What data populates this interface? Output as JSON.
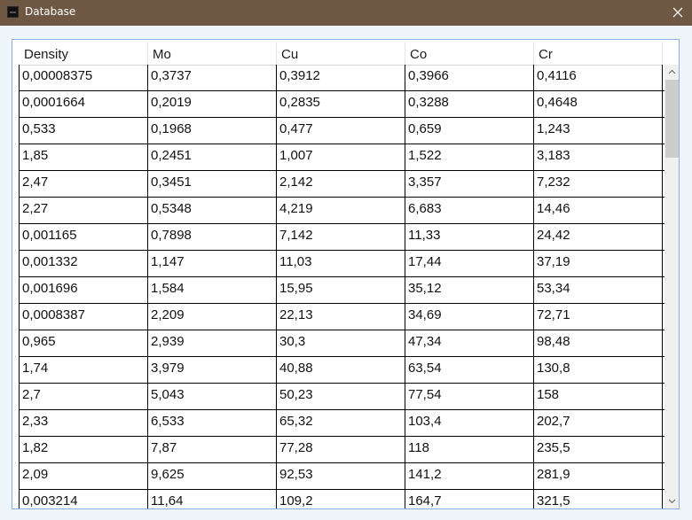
{
  "window": {
    "title": "Database"
  },
  "grid": {
    "columns": [
      "Density",
      "Mo",
      "Cu",
      "Co",
      "Cr"
    ],
    "rows": [
      [
        "0,00008375",
        "0,3737",
        "0,3912",
        "0,3966",
        "0,4116"
      ],
      [
        "0,0001664",
        "0,2019",
        "0,2835",
        "0,3288",
        "0,4648"
      ],
      [
        "0,533",
        "0,1968",
        "0,477",
        "0,659",
        "1,243"
      ],
      [
        "1,85",
        "0,2451",
        "1,007",
        "1,522",
        "3,183"
      ],
      [
        "2,47",
        "0,3451",
        "2,142",
        "3,357",
        "7,232"
      ],
      [
        "2,27",
        "0,5348",
        "4,219",
        "6,683",
        "14,46"
      ],
      [
        "0,001165",
        "0,7898",
        "7,142",
        "11,33",
        "24,42"
      ],
      [
        "0,001332",
        "1,147",
        "11,03",
        "17,44",
        "37,19"
      ],
      [
        "0,001696",
        "1,584",
        "15,95",
        "35,12",
        "53,34"
      ],
      [
        "0,0008387",
        "2,209",
        "22,13",
        "34,69",
        "72,71"
      ],
      [
        "0,965",
        "2,939",
        "30,3",
        "47,34",
        "98,48"
      ],
      [
        "1,74",
        "3,979",
        "40,88",
        "63,54",
        "130,8"
      ],
      [
        "2,7",
        "5,043",
        "50,23",
        "77,54",
        "158"
      ],
      [
        "2,33",
        "6,533",
        "65,32",
        "103,4",
        "202,7"
      ],
      [
        "1,82",
        "7,87",
        "77,28",
        "118",
        "235,5"
      ],
      [
        "2,09",
        "9,625",
        "92,53",
        "141,2",
        "281,9"
      ],
      [
        "0,003214",
        "11,64",
        "109,2",
        "164,7",
        "321,5"
      ]
    ]
  },
  "icons": {
    "app": "app-icon",
    "close": "close-icon",
    "scroll_up": "chevron-up-icon",
    "scroll_down": "chevron-down-icon"
  },
  "colors": {
    "titlebar": "#6f5843",
    "window_bg": "#eef5fb",
    "frame_border": "#8aaede"
  }
}
